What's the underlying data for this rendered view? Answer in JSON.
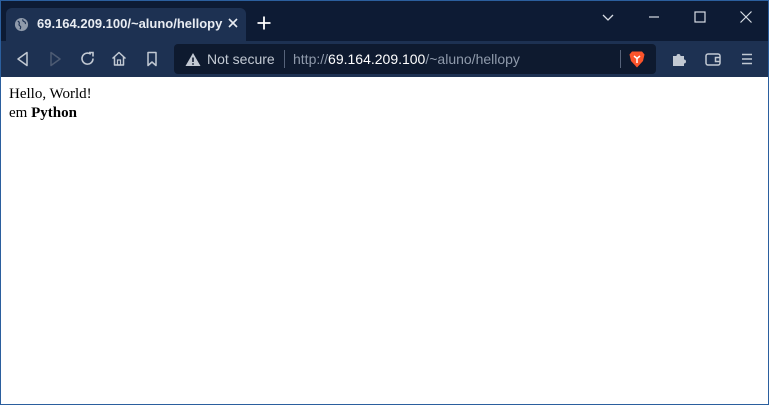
{
  "tab": {
    "title": "69.164.209.100/~aluno/hellopy"
  },
  "address_bar": {
    "security_label": "Not secure",
    "url_scheme": "http://",
    "url_host": "69.164.209.100",
    "url_path": "/~aluno/hellopy"
  },
  "page": {
    "line1": "Hello, World!",
    "line2_prefix": "em",
    "line2_bold": "Python"
  },
  "icons": {
    "tab": [
      "globe-icon",
      "close-icon"
    ],
    "titlebar": [
      "new-tab-icon",
      "tab-search-chevron-icon",
      "minimize-icon",
      "maximize-icon",
      "close-window-icon"
    ],
    "toolbar": [
      "back-icon",
      "forward-icon",
      "reload-icon",
      "home-icon",
      "bookmark-icon",
      "warning-icon",
      "brave-shields-icon",
      "extensions-icon",
      "wallet-icon",
      "menu-icon"
    ]
  },
  "colors": {
    "titlebar": "#0d1b34",
    "toolbar": "#1d3152",
    "urlbar": "#0e1a2f",
    "brave_accent": "#fb542b"
  }
}
